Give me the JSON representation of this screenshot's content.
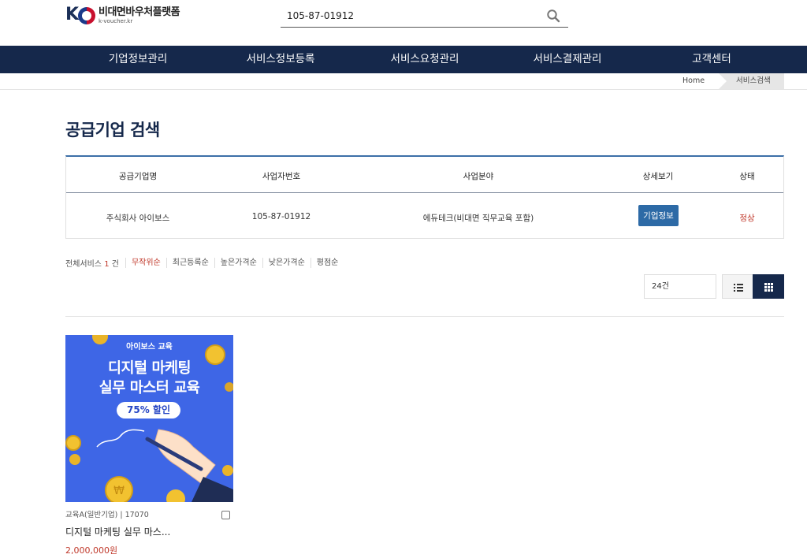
{
  "header": {
    "logo_title": "비대면바우처플랫폼",
    "logo_sub": "k-voucher.kr",
    "search_value": "105-87-01912"
  },
  "nav": {
    "items": [
      {
        "label": "기업정보관리"
      },
      {
        "label": "서비스정보등록"
      },
      {
        "label": "서비스요청관리"
      },
      {
        "label": "서비스결제관리"
      },
      {
        "label": "고객센터"
      }
    ]
  },
  "breadcrumb": {
    "home": "Home",
    "current": "서비스검색"
  },
  "page": {
    "title": "공급기업 검색"
  },
  "company_table": {
    "headers": [
      "공급기업명",
      "사업자번호",
      "사업분야",
      "상세보기",
      "상태"
    ],
    "row": {
      "name": "주식회사 아이보스",
      "biz_no": "105-87-01912",
      "field": "에듀테크(비대면 직무교육 포함)",
      "detail_button": "기업정보",
      "status": "정상"
    }
  },
  "listing": {
    "total_label": "전체서비스",
    "total_count": "1",
    "total_unit": "건",
    "sort_options": [
      {
        "label": "무작위순",
        "active": true
      },
      {
        "label": "최근등록순",
        "active": false
      },
      {
        "label": "높은가격순",
        "active": false
      },
      {
        "label": "낮은가격순",
        "active": false
      },
      {
        "label": "평점순",
        "active": false
      }
    ],
    "per_page": "24건",
    "view_mode": "grid"
  },
  "product": {
    "image_brand": "아이보스 교육",
    "image_headline_1": "디지털 마케팅",
    "image_headline_2": "실무 마스터 교육",
    "image_badge": "75% 할인",
    "meta": "교육A(일반기업) | 17070",
    "name": "디지털 마케팅 실무 마스...",
    "price": "2,000,000원"
  },
  "colors": {
    "nav_bg": "#15284b",
    "accent_red": "#c0392b",
    "button_blue": "#2d6aa6",
    "table_top_border": "#3c6fa8",
    "product_bg": "#3e66e6"
  }
}
